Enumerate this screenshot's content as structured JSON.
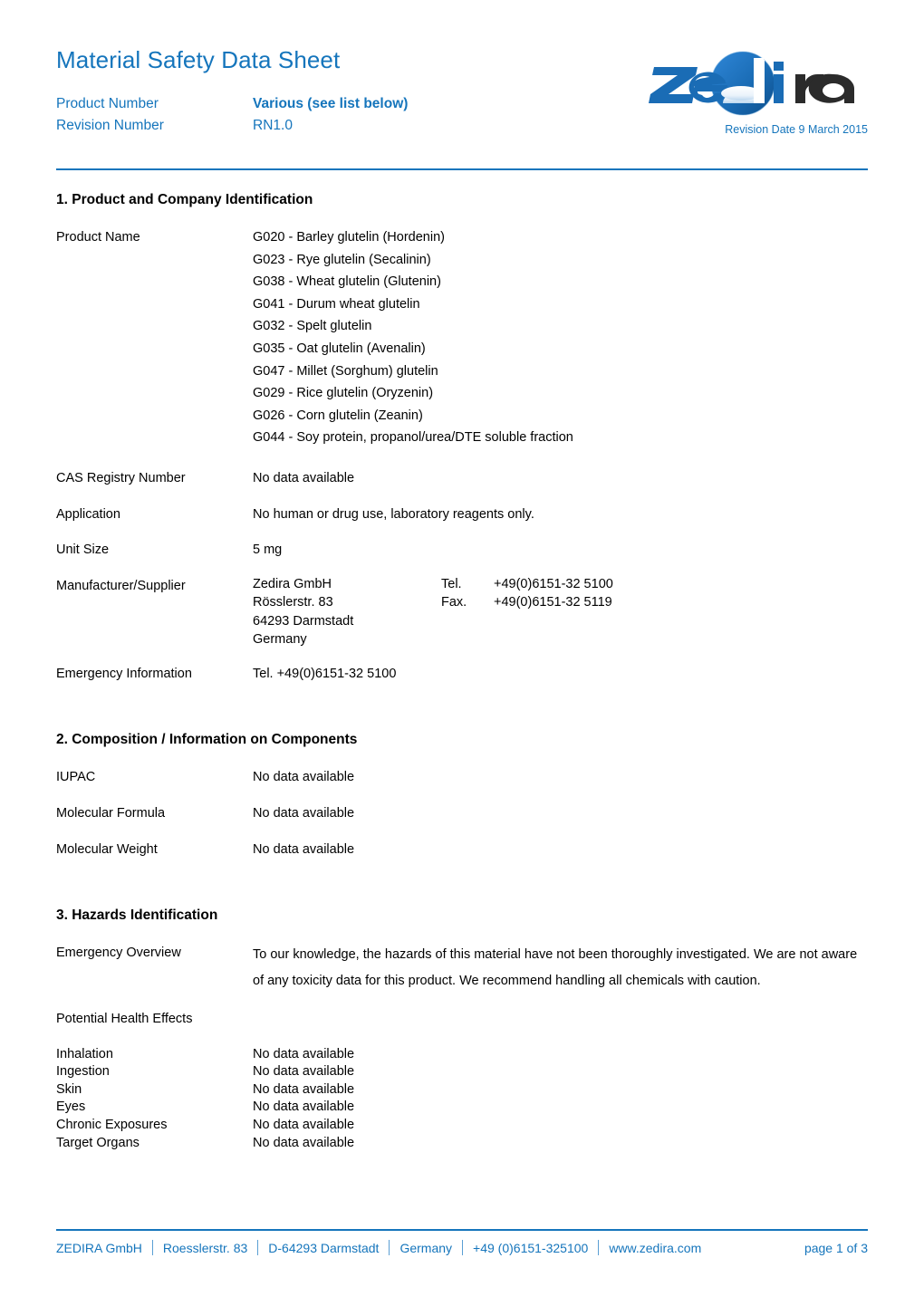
{
  "header": {
    "title": "Material Safety Data Sheet",
    "product_number_label": "Product Number",
    "product_number_value": "Various (see list below)",
    "revision_number_label": "Revision Number",
    "revision_number_value": "RN1.0",
    "revision_date": "Revision Date 9 March 2015",
    "accent_color": "#1575bc",
    "logo_text": "zedira",
    "logo_blue": "#1a6cb5",
    "logo_dark": "#2b2b2b"
  },
  "section1": {
    "title": "1. Product and Company Identification",
    "product_name_label": "Product Name",
    "products": [
      "G020 - Barley glutelin (Hordenin)",
      "G023 - Rye glutelin (Secalinin)",
      "G038 - Wheat glutelin (Glutenin)",
      "G041 - Durum wheat glutelin",
      "G032 - Spelt glutelin",
      "G035 - Oat glutelin (Avenalin)",
      "G047 - Millet (Sorghum) glutelin",
      "G029 - Rice glutelin (Oryzenin)",
      "G026 - Corn glutelin (Zeanin)",
      "G044 - Soy protein, propanol/urea/DTE soluble fraction"
    ],
    "cas_label": "CAS Registry Number",
    "cas_value": "No data available",
    "application_label": "Application",
    "application_value": "No human or drug use, laboratory reagents only.",
    "unit_size_label": "Unit Size",
    "unit_size_value": "5 mg",
    "supplier_label": "Manufacturer/Supplier",
    "supplier_address": [
      "Zedira GmbH",
      "Rösslerstr. 83",
      "64293 Darmstadt",
      "Germany"
    ],
    "tel_key": "Tel.",
    "tel_value": "+49(0)6151-32 5100",
    "fax_key": "Fax.",
    "fax_value": "+49(0)6151-32 5119",
    "emergency_label": "Emergency Information",
    "emergency_value": "Tel. +49(0)6151-32 5100"
  },
  "section2": {
    "title": "2. Composition / Information on Components",
    "rows": [
      {
        "label": "IUPAC",
        "value": "No data available"
      },
      {
        "label": "Molecular Formula",
        "value": "No data available"
      },
      {
        "label": "Molecular Weight",
        "value": "No data available"
      }
    ]
  },
  "section3": {
    "title": "3. Hazards Identification",
    "emergency_overview_label": "Emergency Overview",
    "emergency_overview_text": "To our knowledge, the hazards of this material have not been thoroughly investigated. We are not aware of any toxicity data for this product. We recommend handling all chemicals with caution.",
    "potential_health_effects_label": "Potential Health Effects",
    "health_rows": [
      {
        "label": "Inhalation",
        "value": "No data available"
      },
      {
        "label": "Ingestion",
        "value": "No data available"
      },
      {
        "label": "Skin",
        "value": "No data available"
      },
      {
        "label": "Eyes",
        "value": "No data available"
      },
      {
        "label": "Chronic Exposures",
        "value": "No data available"
      },
      {
        "label": "Target Organs",
        "value": "No data available"
      }
    ]
  },
  "footer": {
    "items": [
      "ZEDIRA GmbH",
      "Roesslerstr. 83",
      "D-64293 Darmstadt",
      "Germany",
      "+49 (0)6151-325100",
      "www.zedira.com"
    ],
    "page_indicator": "page 1 of 3"
  }
}
